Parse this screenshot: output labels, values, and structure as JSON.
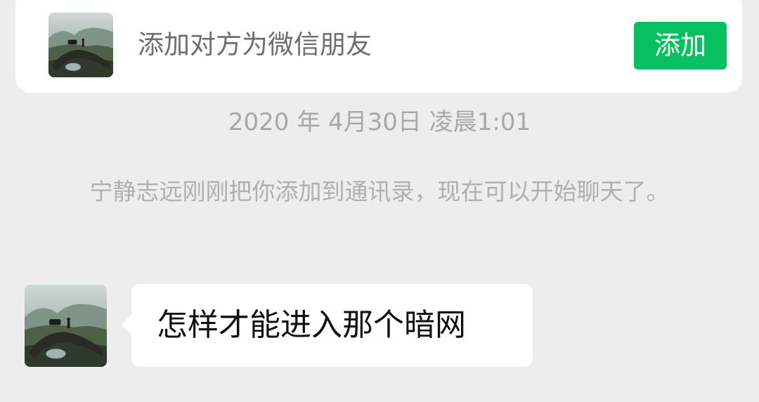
{
  "add_friend_banner": {
    "prompt": "添加对方为微信朋友",
    "button_label": "添加",
    "button_color": "#07c160",
    "avatar_icon": "landscape-bridge-avatar-icon"
  },
  "chat": {
    "timestamp": "2020 年 4月30日 凌晨1:01",
    "system_notice": "宁静志远刚刚把你添加到通讯录，现在可以开始聊天了。",
    "messages": [
      {
        "sender": "contact",
        "avatar_icon": "landscape-bridge-avatar-icon",
        "text": "怎样才能进入那个暗网"
      }
    ]
  },
  "colors": {
    "background": "#ededed",
    "bubble": "#ffffff",
    "muted_text": "#a8a8a8"
  }
}
